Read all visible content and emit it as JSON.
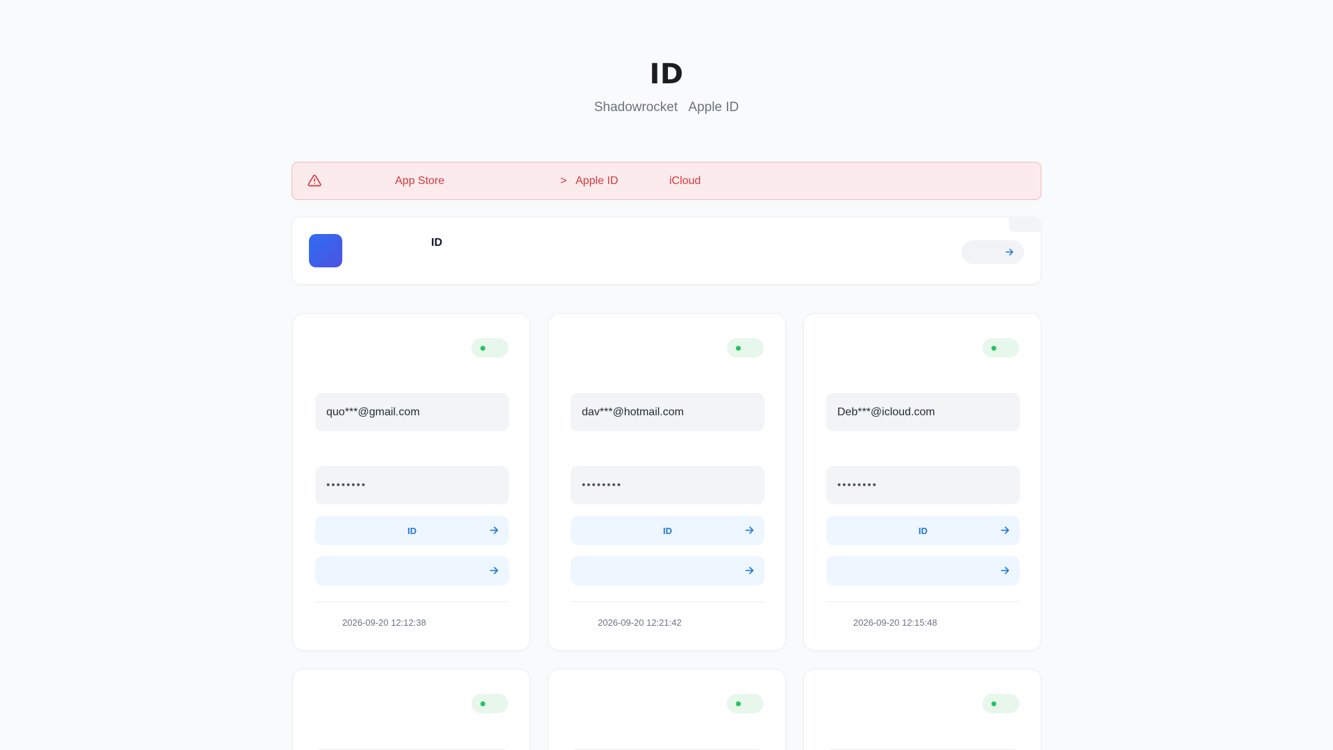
{
  "header": {
    "title": "ID",
    "subtitle_parts": [
      "Shadowrocket",
      "Apple ID"
    ]
  },
  "alert": {
    "icon": "warning-triangle-icon",
    "text_app_store": "App Store",
    "text_arrow": ">",
    "text_apple_id": "Apple ID",
    "text_icloud": "iCloud"
  },
  "app_banner": {
    "title": "ID"
  },
  "cards": [
    {
      "email": "quo***@gmail.com",
      "password": "••••••••",
      "action1_label": "ID",
      "action2_label": "",
      "timestamp": "2026-09-20 12:12:38"
    },
    {
      "email": "dav***@hotmail.com",
      "password": "••••••••",
      "action1_label": "ID",
      "action2_label": "",
      "timestamp": "2026-09-20 12:21:42"
    },
    {
      "email": "Deb***@icloud.com",
      "password": "••••••••",
      "action1_label": "ID",
      "action2_label": "",
      "timestamp": "2026-09-20 12:15:48"
    }
  ],
  "colors": {
    "alert_text": "#d2373c",
    "accent": "#1e77d8",
    "status_ok": "#22c55e",
    "app_icon_gradient": [
      "#2f6df3",
      "#4c53e2"
    ]
  }
}
